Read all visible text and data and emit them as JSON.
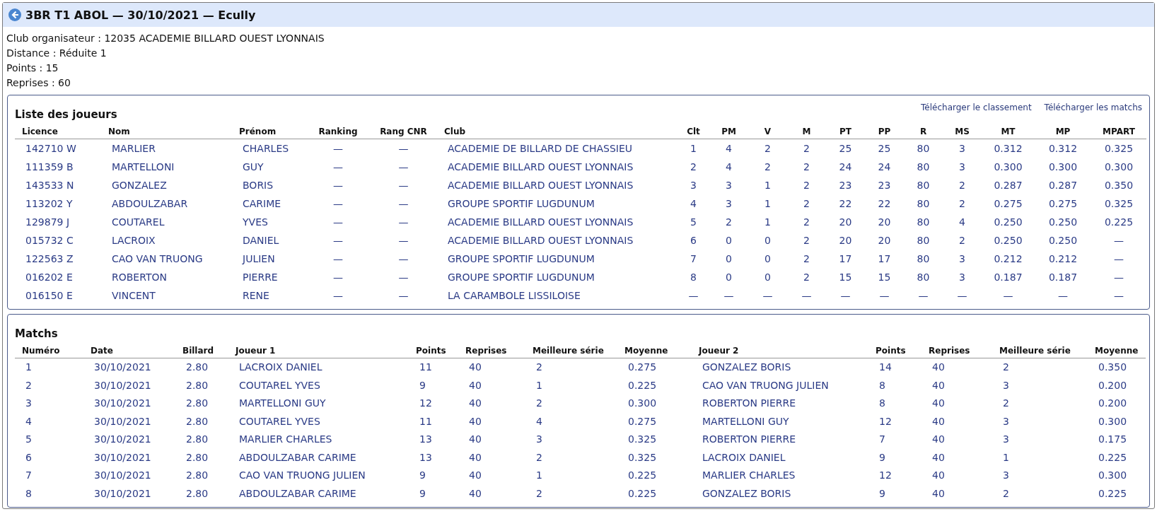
{
  "header": {
    "title": "3BR T1 ABOL — 30/10/2021 — Ecully"
  },
  "info": [
    "Club organisateur : 12035 ACADEMIE BILLARD OUEST LYONNAIS",
    "Distance : Réduite 1",
    "Points : 15",
    "Reprises : 60"
  ],
  "players": {
    "title": "Liste des joueurs",
    "links": [
      "Télécharger le classement",
      "Télécharger les matchs"
    ],
    "columns": [
      "Licence",
      "Nom",
      "Prénom",
      "Ranking",
      "Rang CNR",
      "Club",
      "Clt",
      "PM",
      "V",
      "M",
      "PT",
      "PP",
      "R",
      "MS",
      "MT",
      "MP",
      "MPART"
    ],
    "rows": [
      [
        "142710 W",
        "MARLIER",
        "CHARLES",
        "—",
        "—",
        "ACADEMIE DE BILLARD DE CHASSIEU",
        "1",
        "4",
        "2",
        "2",
        "25",
        "25",
        "80",
        "3",
        "0.312",
        "0.312",
        "0.325"
      ],
      [
        "111359 B",
        "MARTELLONI",
        "GUY",
        "—",
        "—",
        "ACADEMIE BILLARD OUEST LYONNAIS",
        "2",
        "4",
        "2",
        "2",
        "24",
        "24",
        "80",
        "3",
        "0.300",
        "0.300",
        "0.300"
      ],
      [
        "143533 N",
        "GONZALEZ",
        "BORIS",
        "—",
        "—",
        "ACADEMIE BILLARD OUEST LYONNAIS",
        "3",
        "3",
        "1",
        "2",
        "23",
        "23",
        "80",
        "2",
        "0.287",
        "0.287",
        "0.350"
      ],
      [
        "113202 Y",
        "ABDOULZABAR",
        "CARIME",
        "—",
        "—",
        "GROUPE SPORTIF LUGDUNUM",
        "4",
        "3",
        "1",
        "2",
        "22",
        "22",
        "80",
        "2",
        "0.275",
        "0.275",
        "0.325"
      ],
      [
        "129879 J",
        "COUTAREL",
        "YVES",
        "—",
        "—",
        "ACADEMIE BILLARD OUEST LYONNAIS",
        "5",
        "2",
        "1",
        "2",
        "20",
        "20",
        "80",
        "4",
        "0.250",
        "0.250",
        "0.225"
      ],
      [
        "015732 C",
        "LACROIX",
        "DANIEL",
        "—",
        "—",
        "ACADEMIE BILLARD OUEST LYONNAIS",
        "6",
        "0",
        "0",
        "2",
        "20",
        "20",
        "80",
        "2",
        "0.250",
        "0.250",
        "—"
      ],
      [
        "122563 Z",
        "CAO VAN TRUONG",
        "JULIEN",
        "—",
        "—",
        "GROUPE SPORTIF LUGDUNUM",
        "7",
        "0",
        "0",
        "2",
        "17",
        "17",
        "80",
        "3",
        "0.212",
        "0.212",
        "—"
      ],
      [
        "016202 E",
        "ROBERTON",
        "PIERRE",
        "—",
        "—",
        "GROUPE SPORTIF LUGDUNUM",
        "8",
        "0",
        "0",
        "2",
        "15",
        "15",
        "80",
        "3",
        "0.187",
        "0.187",
        "—"
      ],
      [
        "016150 E",
        "VINCENT",
        "RENE",
        "—",
        "—",
        "LA CARAMBOLE LISSILOISE",
        "—",
        "—",
        "—",
        "—",
        "—",
        "—",
        "—",
        "—",
        "—",
        "—",
        "—"
      ]
    ]
  },
  "matches": {
    "title": "Matchs",
    "columns": [
      "Numéro",
      "Date",
      "Billard",
      "Joueur 1",
      "Points",
      "Reprises",
      "Meilleure série",
      "Moyenne",
      "Joueur 2",
      "Points",
      "Reprises",
      "Meilleure série",
      "Moyenne"
    ],
    "rows": [
      [
        "1",
        "30/10/2021",
        "2.80",
        "LACROIX DANIEL",
        "11",
        "40",
        "2",
        "0.275",
        "GONZALEZ BORIS",
        "14",
        "40",
        "2",
        "0.350"
      ],
      [
        "2",
        "30/10/2021",
        "2.80",
        "COUTAREL YVES",
        "9",
        "40",
        "1",
        "0.225",
        "CAO VAN TRUONG JULIEN",
        "8",
        "40",
        "3",
        "0.200"
      ],
      [
        "3",
        "30/10/2021",
        "2.80",
        "MARTELLONI GUY",
        "12",
        "40",
        "2",
        "0.300",
        "ROBERTON PIERRE",
        "8",
        "40",
        "2",
        "0.200"
      ],
      [
        "4",
        "30/10/2021",
        "2.80",
        "COUTAREL YVES",
        "11",
        "40",
        "4",
        "0.275",
        "MARTELLONI GUY",
        "12",
        "40",
        "3",
        "0.300"
      ],
      [
        "5",
        "30/10/2021",
        "2.80",
        "MARLIER CHARLES",
        "13",
        "40",
        "3",
        "0.325",
        "ROBERTON PIERRE",
        "7",
        "40",
        "3",
        "0.175"
      ],
      [
        "6",
        "30/10/2021",
        "2.80",
        "ABDOULZABAR CARIME",
        "13",
        "40",
        "2",
        "0.325",
        "LACROIX DANIEL",
        "9",
        "40",
        "1",
        "0.225"
      ],
      [
        "7",
        "30/10/2021",
        "2.80",
        "CAO VAN TRUONG JULIEN",
        "9",
        "40",
        "1",
        "0.225",
        "MARLIER CHARLES",
        "12",
        "40",
        "3",
        "0.300"
      ],
      [
        "8",
        "30/10/2021",
        "2.80",
        "ABDOULZABAR CARIME",
        "9",
        "40",
        "2",
        "0.225",
        "GONZALEZ BORIS",
        "9",
        "40",
        "2",
        "0.225"
      ]
    ]
  }
}
